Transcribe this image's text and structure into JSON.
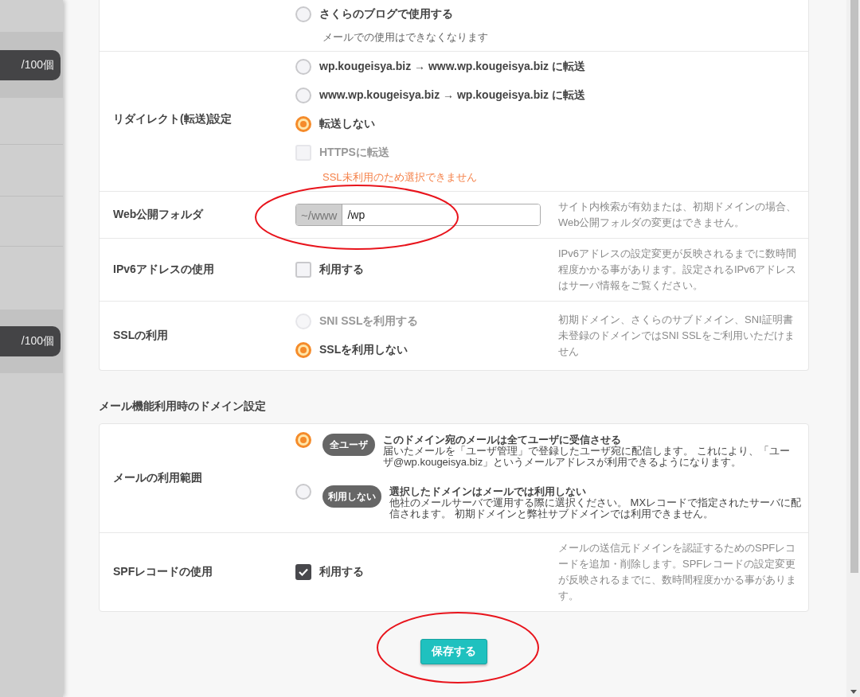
{
  "background_page": {
    "counters": [
      {
        "text": "/100個"
      },
      {
        "text": "/100個"
      }
    ]
  },
  "web_settings": {
    "rows": [
      {
        "options": [
          {
            "kind": "radio",
            "label": "さくらのブログで使用する",
            "selected": false,
            "disabled": false
          }
        ],
        "note": "メールでの使用はできなくなります"
      },
      {
        "label": "リダイレクト(転送)設定",
        "options": [
          {
            "kind": "radio",
            "label": "wp.kougeisya.biz → www.wp.kougeisya.biz に転送",
            "selected": false,
            "disabled": false
          },
          {
            "kind": "radio",
            "label": "www.wp.kougeisya.biz → wp.kougeisya.biz に転送",
            "selected": false,
            "disabled": false
          },
          {
            "kind": "radio",
            "label": "転送しない",
            "selected": true,
            "disabled": false
          },
          {
            "kind": "checkbox",
            "label": "HTTPSに転送",
            "checked": false,
            "disabled": true
          }
        ],
        "warning": "SSL未利用のため選択できません"
      },
      {
        "label": "Web公開フォルダ",
        "field": {
          "prefix": "~/www",
          "value": "/wp"
        },
        "help": "サイト内検索が有効または、初期ドメインの場合、Web公開フォルダの変更はできません。"
      },
      {
        "label": "IPv6アドレスの使用",
        "options": [
          {
            "kind": "checkbox",
            "label": "利用する",
            "checked": false,
            "disabled": false
          }
        ],
        "help": "IPv6アドレスの設定変更が反映されるまでに数時間程度かかる事があります。設定されるIPv6アドレスはサーバ情報をご覧ください。"
      },
      {
        "label": "SSLの利用",
        "options": [
          {
            "kind": "radio",
            "label": "SNI SSLを利用する",
            "selected": false,
            "disabled": true
          },
          {
            "kind": "radio",
            "label": "SSLを利用しない",
            "selected": true,
            "disabled": false
          }
        ],
        "help": "初期ドメイン、さくらのサブドメイン、SNI証明書未登録のドメインではSNI SSLをご利用いただけません"
      }
    ]
  },
  "mail_settings": {
    "title": "メール機能利用時のドメイン設定",
    "rows": [
      {
        "label": "メールの利用範囲",
        "options": [
          {
            "kind": "mail_radio",
            "badge": "全ユーザ",
            "title": "このドメイン宛のメールは全てユーザに受信させる",
            "description": "届いたメールを「ユーザ管理」で登録したユーザ宛に配信します。 これにより、「ユーザ@wp.kougeisya.biz」というメールアドレスが利用できるようになります。",
            "selected": true
          },
          {
            "kind": "mail_radio",
            "badge": "利用しない",
            "title": "選択したドメインはメールでは利用しない",
            "description": "他社のメールサーバで運用する際に選択ください。 MXレコードで指定されたサーバに配信されます。 初期ドメインと弊社サブドメインでは利用できません。",
            "selected": false
          }
        ]
      },
      {
        "label": "SPFレコードの使用",
        "options": [
          {
            "kind": "checkbox",
            "label": "利用する",
            "checked": true,
            "disabled": false
          }
        ],
        "help": "メールの送信元ドメインを認証するためのSPFレコードを追加・削除します。SPFレコードの設定変更が反映されるまでに、数時間程度かかる事があります。"
      }
    ]
  },
  "save_button": {
    "label": "保存する"
  }
}
